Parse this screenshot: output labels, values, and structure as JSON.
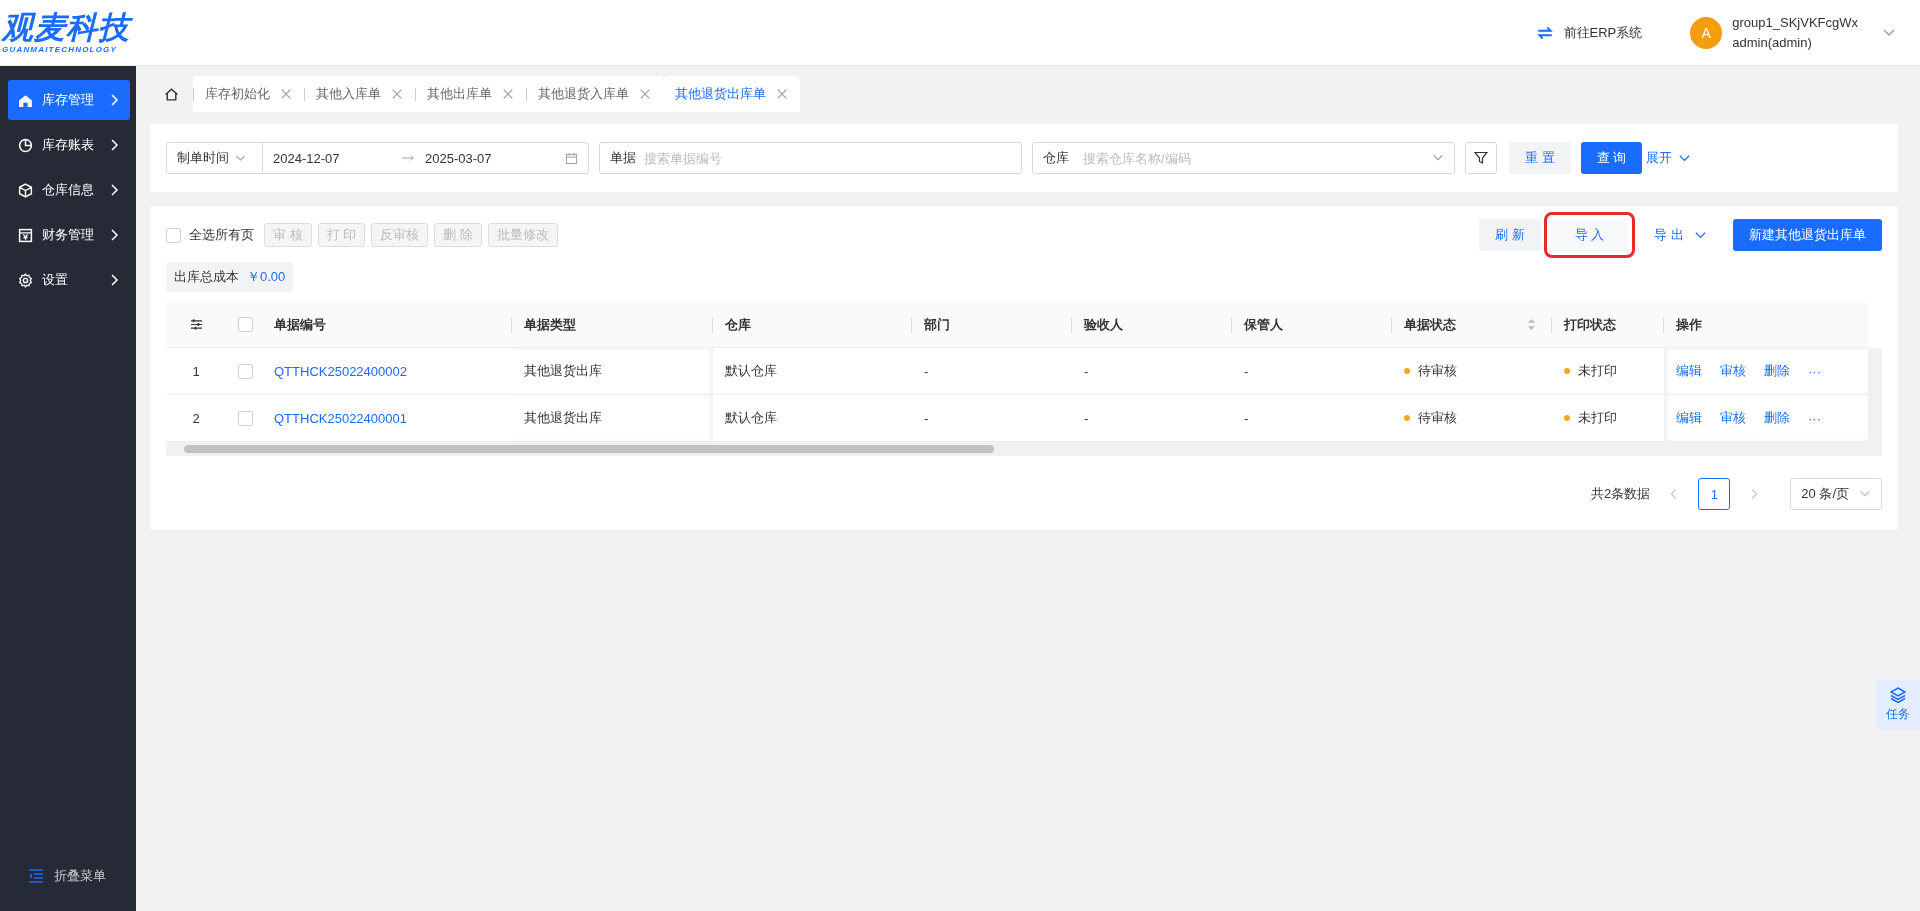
{
  "header": {
    "logo": {
      "title": "观麦科技",
      "subtitle": "GUANMAITECHNOLOGY"
    },
    "erp_link": "前往ERP系统",
    "user": {
      "avatar": "A",
      "name": "group1_SKjVKFcgWx",
      "role": "admin(admin)"
    }
  },
  "sidebar": {
    "items": [
      {
        "label": "库存管理",
        "selected": true
      },
      {
        "label": "库存账表",
        "selected": false
      },
      {
        "label": "仓库信息",
        "selected": false
      },
      {
        "label": "财务管理",
        "selected": false
      },
      {
        "label": "设置",
        "selected": false
      }
    ],
    "collapse": "折叠菜单"
  },
  "tabs": [
    {
      "kind": "home",
      "selected": false
    },
    {
      "kind": "page",
      "label": "库存初始化",
      "selected": false
    },
    {
      "kind": "page",
      "label": "其他入库单",
      "selected": false
    },
    {
      "kind": "page",
      "label": "其他出库单",
      "selected": false
    },
    {
      "kind": "page",
      "label": "其他退货入库单",
      "selected": false
    },
    {
      "kind": "page",
      "label": "其他退货出库单",
      "selected": true
    }
  ],
  "filters": {
    "date_type": "制单时间",
    "start_date": "2024-12-07",
    "end_date": "2025-03-07",
    "document": {
      "label": "单据",
      "placeholder": "搜索单据编号"
    },
    "warehouse": {
      "label": "仓库",
      "placeholder": "搜索仓库名称/编码"
    },
    "reset": "重 置",
    "query": "查 询",
    "expand": "展开"
  },
  "toolbar": {
    "select_all": {
      "label": "全选所有页",
      "checked": false
    },
    "batch_buttons": [
      {
        "label": "审 核",
        "disabled": true
      },
      {
        "label": "打 印",
        "disabled": true
      },
      {
        "label": "反审核",
        "disabled": true
      },
      {
        "label": "删 除",
        "disabled": true
      },
      {
        "label": "批量修改",
        "disabled": true
      }
    ],
    "actions": [
      {
        "kind": "plain",
        "label": "刷 新",
        "highlighted": false
      },
      {
        "kind": "plain",
        "label": "导 入",
        "highlighted": true
      },
      {
        "kind": "dropdown",
        "label": "导 出",
        "highlighted": false
      },
      {
        "kind": "primary",
        "label": "新建其他退货出库单",
        "highlighted": false
      }
    ]
  },
  "summary": {
    "label": "出库总成本",
    "value": "￥0.00"
  },
  "table": {
    "header_checked": false,
    "columns": [
      {
        "label": "单据编号",
        "sortable": false
      },
      {
        "label": "单据类型",
        "sortable": false
      },
      {
        "label": "仓库",
        "sortable": false
      },
      {
        "label": "部门",
        "sortable": false
      },
      {
        "label": "验收人",
        "sortable": false
      },
      {
        "label": "保管人",
        "sortable": false
      },
      {
        "label": "单据状态",
        "sortable": true
      },
      {
        "label": "打印状态",
        "sortable": false
      },
      {
        "label": "操作",
        "sortable": false
      }
    ],
    "rows": [
      {
        "index": "1",
        "checked": false,
        "number": "QTTHCK25022400002",
        "type": "其他退货出库",
        "warehouse": "默认仓库",
        "department": "-",
        "inspector": "-",
        "keeper": "-",
        "status": {
          "text": "待审核",
          "color": "#f5a623"
        },
        "print_status": {
          "text": "未打印",
          "color": "#f5a623"
        },
        "actions": [
          "编辑",
          "审核",
          "删除",
          "···"
        ]
      },
      {
        "index": "2",
        "checked": false,
        "number": "QTTHCK25022400001",
        "type": "其他退货出库",
        "warehouse": "默认仓库",
        "department": "-",
        "inspector": "-",
        "keeper": "-",
        "status": {
          "text": "待审核",
          "color": "#f5a623"
        },
        "print_status": {
          "text": "未打印",
          "color": "#f5a623"
        },
        "actions": [
          "编辑",
          "审核",
          "删除",
          "···"
        ]
      }
    ]
  },
  "pagination": {
    "total": "共2条数据",
    "pages": [
      {
        "label": "1",
        "selected": true
      }
    ],
    "page_size": "20 条/页"
  },
  "float_button": "任务"
}
